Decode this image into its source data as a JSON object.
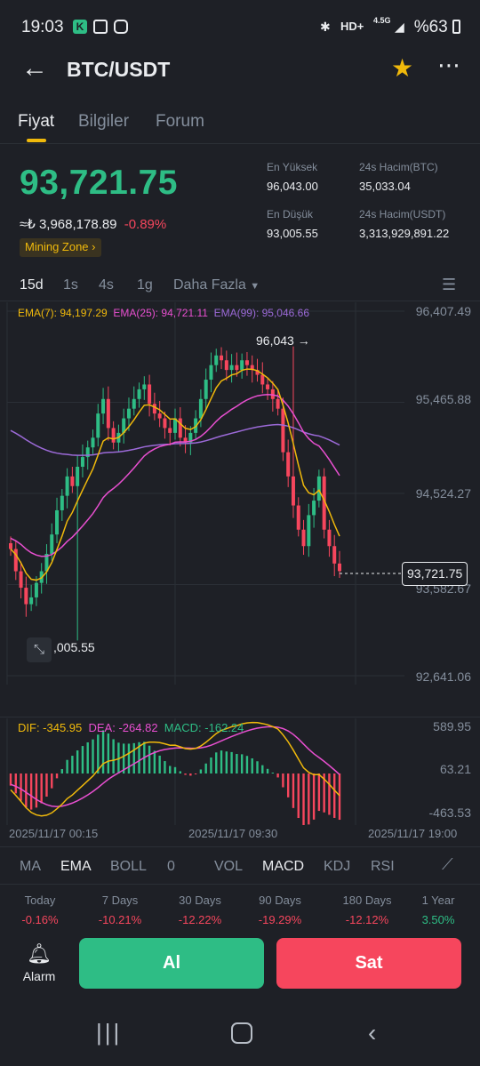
{
  "status_bar": {
    "time": "19:03",
    "battery": "%63",
    "network": "4.5G"
  },
  "header": {
    "title": "BTC/USDT"
  },
  "tabs": [
    "Fiyat",
    "Bilgiler",
    "Forum"
  ],
  "price": {
    "last": "93,721.75",
    "fiat": "≈₺ 3,968,178.89",
    "change": "-0.89%",
    "zone_label": "Mining Zone"
  },
  "stats": {
    "high_label": "En Yüksek",
    "high": "96,043.00",
    "low_label": "En Düşük",
    "low": "93,005.55",
    "vol_btc_label": "24s Hacim(BTC)",
    "vol_btc": "35,033.04",
    "vol_usdt_label": "24s Hacim(USDT)",
    "vol_usdt": "3,313,929,891.22"
  },
  "timeframes": [
    "15d",
    "1s",
    "4s",
    "1g",
    "Daha Fazla"
  ],
  "ema_legend": {
    "ema7": "EMA(7): 94,197.29",
    "ema25": "EMA(25): 94,721.11",
    "ema99": "EMA(99): 95,046.66"
  },
  "price_axis": [
    "96,407.49",
    "95,465.88",
    "94,524.27",
    "93,582.67",
    "92,641.06"
  ],
  "chart_markers": {
    "high_marker": "96,043",
    "low_marker": ",005.55",
    "last_price_tag": "93,721.75"
  },
  "macd_legend": {
    "dif": "DIF: -345.95",
    "dea": "DEA: -264.82",
    "macd": "MACD: -162.24"
  },
  "macd_axis": [
    "589.95",
    "63.21",
    "-463.53"
  ],
  "time_axis": [
    "2025/11/17 00:15",
    "2025/11/17 09:30",
    "2025/11/17 19:00"
  ],
  "indicators": {
    "main": [
      "MA",
      "EMA",
      "BOLL",
      "0"
    ],
    "sub": [
      "VOL",
      "MACD",
      "KDJ",
      "RSI"
    ]
  },
  "performance": [
    {
      "label": "Today",
      "value": "-0.16%",
      "color": "#f6465d"
    },
    {
      "label": "7 Days",
      "value": "-10.21%",
      "color": "#f6465d"
    },
    {
      "label": "30 Days",
      "value": "-12.22%",
      "color": "#f6465d"
    },
    {
      "label": "90 Days",
      "value": "-19.29%",
      "color": "#f6465d"
    },
    {
      "label": "180 Days",
      "value": "-12.12%",
      "color": "#f6465d"
    },
    {
      "label": "1 Year",
      "value": "3.50%",
      "color": "#2ebd85"
    }
  ],
  "actions": {
    "alarm": "Alarm",
    "buy": "Al",
    "sell": "Sat"
  },
  "colors": {
    "up": "#2ebd85",
    "down": "#f6465d",
    "accent": "#f0b90b",
    "ema7": "#f0b90b",
    "ema25": "#e84fd0",
    "ema99": "#9c6ad8"
  },
  "chart_data": {
    "type": "candlestick",
    "pair": "BTC/USDT",
    "interval": "15d",
    "ylim": [
      92641.06,
      96407.49
    ],
    "high": 96043,
    "low": 93005.55,
    "last": 93721.75,
    "close_series": [
      93950,
      93720,
      93550,
      93380,
      93450,
      93600,
      93720,
      93900,
      94100,
      94350,
      94500,
      94700,
      94600,
      94800,
      94900,
      95000,
      95100,
      95350,
      95500,
      95200,
      95050,
      95150,
      95300,
      95400,
      95500,
      95600,
      95650,
      95450,
      95350,
      95300,
      95200,
      95150,
      95300,
      95100,
      95050,
      95150,
      95300,
      95500,
      95700,
      95850,
      95950,
      95900,
      95800,
      95850,
      95800,
      95900,
      95850,
      95800,
      95750,
      95650,
      95600,
      95500,
      95400,
      94950,
      94700,
      94400,
      94150,
      93980,
      94300,
      94450,
      94700,
      94150,
      93980,
      93800,
      93721.75
    ]
  }
}
